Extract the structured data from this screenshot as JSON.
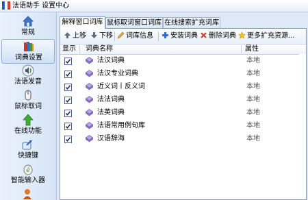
{
  "window": {
    "title": "法语助手 设置中心"
  },
  "sidebar": {
    "items": [
      {
        "label": "常规",
        "icon": "home-icon"
      },
      {
        "label": "词典设置",
        "icon": "books-icon"
      },
      {
        "label": "法语发音",
        "icon": "speaker-icon"
      },
      {
        "label": "鼠标取词",
        "icon": "mouse-icon"
      },
      {
        "label": "在线功能",
        "icon": "upload-arrow-icon"
      },
      {
        "label": "快捷键",
        "icon": "shortcut-arrow-icon"
      },
      {
        "label": "智能输入器",
        "icon": "input-icon"
      }
    ],
    "active_index": 1
  },
  "tabs": [
    {
      "label": "解释窗口词库"
    },
    {
      "label": "鼠标取词窗口词库"
    },
    {
      "label": "在线搜索扩充词库"
    }
  ],
  "toolbar": {
    "move_up": "上移",
    "move_down": "下移",
    "dict_info": "词库信息",
    "install": "安装词典",
    "remove": "删除词典",
    "more": "更多扩充资源..."
  },
  "table": {
    "columns": {
      "show": "显示",
      "name": "词典名称",
      "attr": "属性"
    },
    "rows": [
      {
        "checked": true,
        "name": "法汉词典",
        "attr": "本地"
      },
      {
        "checked": true,
        "name": "法汉专业词典",
        "attr": "本地"
      },
      {
        "checked": true,
        "name": "近义词丨反义词",
        "attr": "本地"
      },
      {
        "checked": true,
        "name": "法法词典",
        "attr": "本地"
      },
      {
        "checked": true,
        "name": "法英词典",
        "attr": "本地"
      },
      {
        "checked": true,
        "name": "法语常用例句库",
        "attr": "本地"
      },
      {
        "checked": true,
        "name": "汉语辞海",
        "attr": "本地"
      }
    ]
  },
  "colors": {
    "accent": "#7f9dc7",
    "sidebar_bg": "#dfe8f6"
  }
}
